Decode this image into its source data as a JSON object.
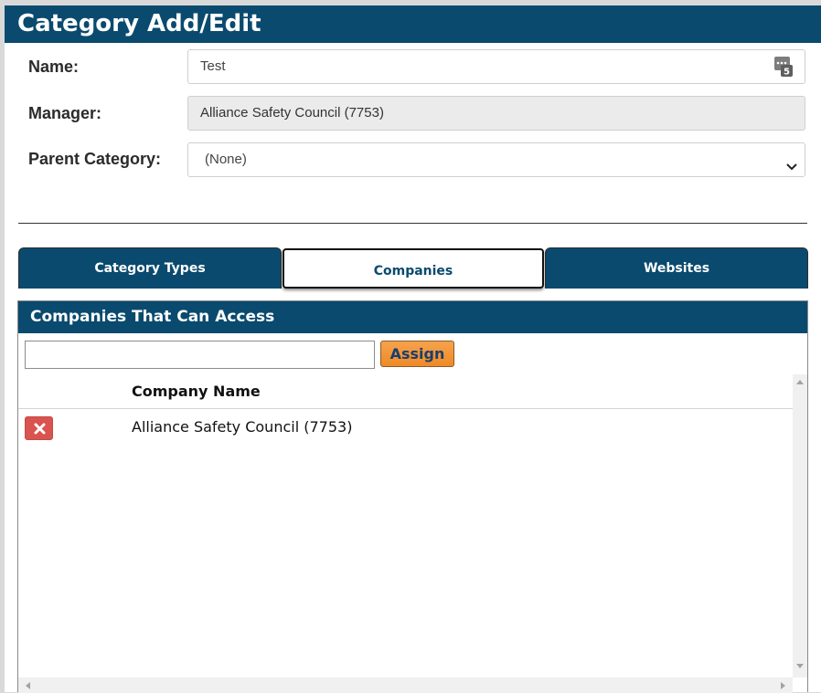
{
  "page": {
    "title": "Category Add/Edit"
  },
  "form": {
    "name_label": "Name:",
    "name_value": "Test",
    "manager_label": "Manager:",
    "manager_value": "Alliance Safety Council (7753)",
    "parent_label": "Parent Category:",
    "parent_value": "(None)"
  },
  "tabs": [
    {
      "label": "Category Types",
      "active": false
    },
    {
      "label": "Companies",
      "active": true
    },
    {
      "label": "Websites",
      "active": false
    }
  ],
  "companies": {
    "header": "Companies That Can Access",
    "assign_input_value": "",
    "assign_label": "Assign",
    "column_header": "Company Name",
    "rows": [
      {
        "name": "Alliance Safety Council (7753)"
      }
    ]
  },
  "colors": {
    "primary": "#0a4a6e",
    "assign_button": "#ee8a25",
    "delete_button": "#d9534f"
  },
  "icons": {
    "name_field": "counter-icon",
    "parent_select": "chevron-down-icon",
    "row_action": "close-icon"
  }
}
